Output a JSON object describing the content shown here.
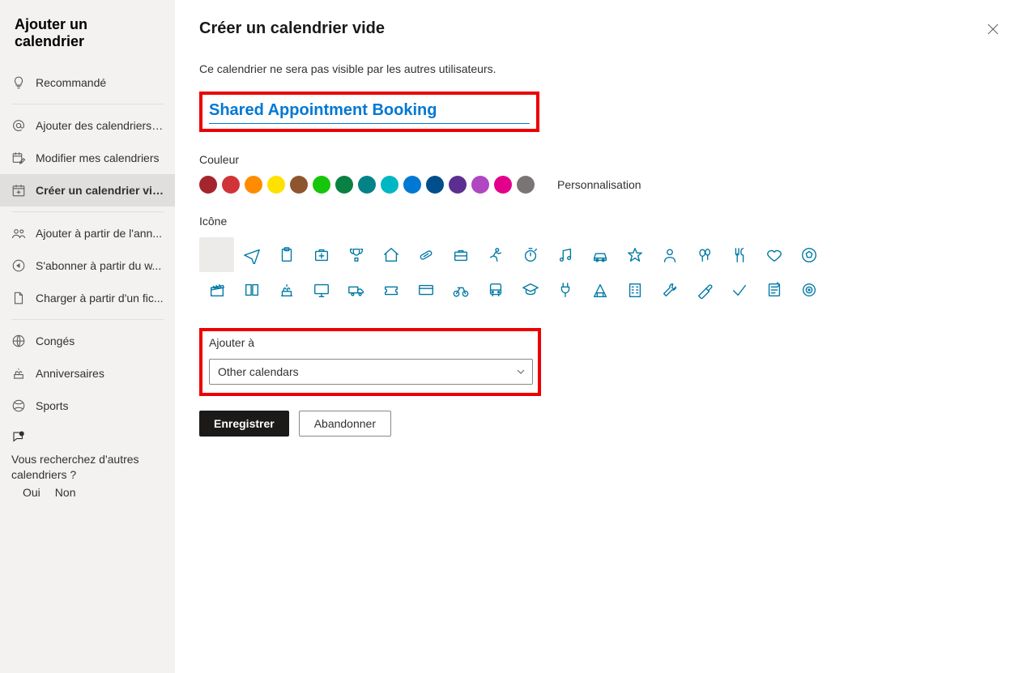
{
  "sidebar": {
    "title": "Ajouter un calendrier",
    "items": [
      {
        "label": "Recommandé",
        "iconName": "lightbulb-icon"
      },
      {
        "label": "Ajouter des calendriers ...",
        "iconName": "at-icon"
      },
      {
        "label": "Modifier mes calendriers",
        "iconName": "calendar-edit-icon"
      },
      {
        "label": "Créer un calendrier vide",
        "iconName": "calendar-add-icon",
        "selected": true
      },
      {
        "label": "Ajouter à partir de l'ann...",
        "iconName": "people-icon"
      },
      {
        "label": "S'abonner à partir du w...",
        "iconName": "subscribe-icon"
      },
      {
        "label": "Charger à partir d'un fic...",
        "iconName": "file-icon"
      },
      {
        "label": "Congés",
        "iconName": "globe-icon"
      },
      {
        "label": "Anniversaires",
        "iconName": "cake-icon"
      },
      {
        "label": "Sports",
        "iconName": "sport-icon"
      }
    ],
    "dividerAfter": [
      0,
      3,
      6
    ],
    "feedback": {
      "text": "Vous recherchez d'autres calendriers ?",
      "yes": "Oui",
      "no": "Non"
    }
  },
  "main": {
    "title": "Créer un calendrier vide",
    "helper": "Ce calendrier ne sera pas visible par les autres utilisateurs.",
    "nameValue": "Shared Appointment Booking",
    "colorLabel": "Couleur",
    "colors": [
      "#a4262c",
      "#d13438",
      "#ff8c00",
      "#ffe100",
      "#8e562e",
      "#16c60c",
      "#0b8043",
      "#038387",
      "#00b7c3",
      "#0078d4",
      "#004e8c",
      "#5c2e91",
      "#b146c2",
      "#e3008c",
      "#7a7574"
    ],
    "customizeLabel": "Personnalisation",
    "iconLabel": "Icône",
    "iconNames": [
      "blank",
      "airplane",
      "clipboard",
      "first-aid",
      "trophy",
      "home",
      "pill",
      "briefcase",
      "person-run",
      "stopwatch",
      "music",
      "car",
      "star",
      "person",
      "balloons",
      "food",
      "heart",
      "soccer",
      "clapper",
      "book",
      "birthday",
      "monitor",
      "truck",
      "ticket",
      "credit-card",
      "bike",
      "bus",
      "graduation",
      "plug",
      "building",
      "office",
      "wrench",
      "paint",
      "check",
      "notes",
      "target"
    ],
    "addTo": {
      "label": "Ajouter à",
      "value": "Other calendars"
    },
    "buttons": {
      "save": "Enregistrer",
      "cancel": "Abandonner"
    }
  }
}
